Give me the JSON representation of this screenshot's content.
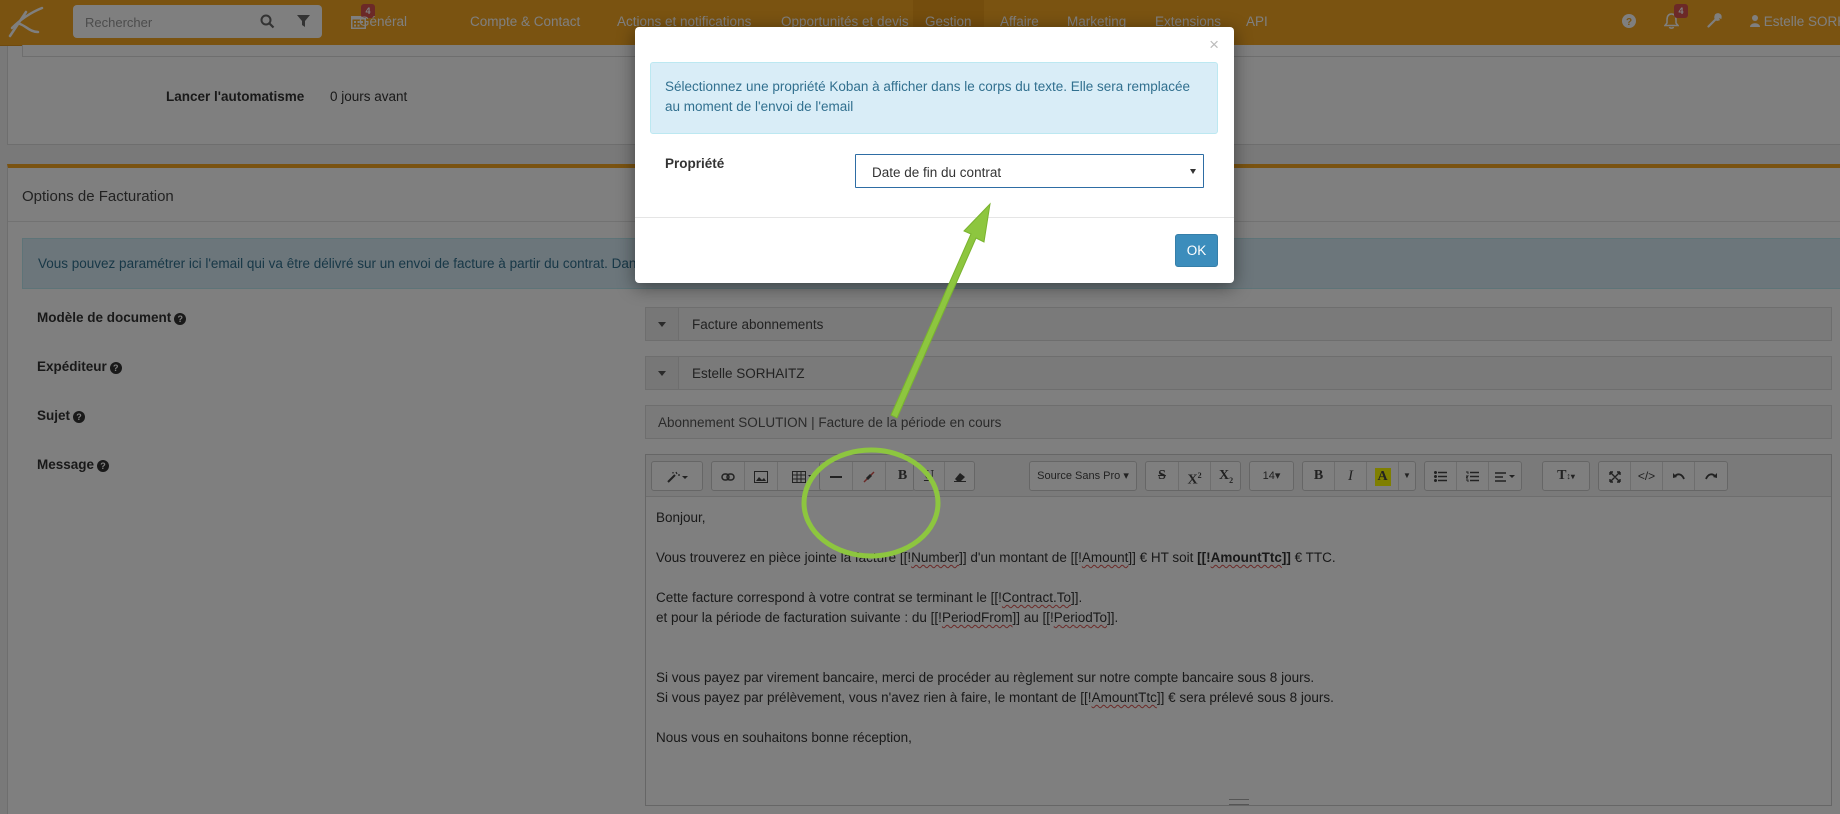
{
  "navbar": {
    "search_placeholder": "Rechercher",
    "calendar_badge": "4",
    "menu": [
      "Général",
      "Compte & Contact",
      "Actions et notifications",
      "Opportunités et devis",
      "Gestion",
      "Affaire",
      "Marketing",
      "Extensions",
      "API"
    ],
    "active_item": "Gestion",
    "notifications_badge": "4",
    "user_name": "Estelle SORH"
  },
  "automation": {
    "label": "Lancer l'automatisme",
    "value": "0 jours avant"
  },
  "billing": {
    "title": "Options de Facturation",
    "info": "Vous pouvez paramétrer ici l'email qui va être délivré sur un envoi de facture à partir du contrat. Dans le",
    "doc_model_label": "Modèle de document",
    "doc_model_value": "Facture abonnements",
    "sender_label": "Expéditeur",
    "sender_value": "Estelle SORHAITZ",
    "subject_label": "Sujet",
    "subject_value": "Abonnement SOLUTION | Facture de la période en cours",
    "message_label": "Message"
  },
  "editor": {
    "font_name": "Source Sans Pro",
    "font_size": "14",
    "lines": {
      "l1": "Bonjour,",
      "l2a": "Vous trouverez en pièce jointe la facture [[!",
      "l2b": "Number",
      "l2c": "]] d'un montant de  [[!",
      "l2d": "Amount",
      "l2e": "]] € HT soit ",
      "l2f": "[[!",
      "l2g": "AmountTtc",
      "l2h": "]]",
      "l2i": " € TTC.",
      "l3a": "Cette facture correspond à votre contrat se terminant le [[!",
      "l3b": "Contract.To",
      "l3c": "]].",
      "l4a": "et pour la période de facturation suivante : du [[!",
      "l4b": "PeriodFrom",
      "l4c": "]] au [[!",
      "l4d": "PeriodTo",
      "l4e": "]].",
      "l5": "Si vous payez par virement bancaire, merci de procéder au règlement sur notre compte bancaire sous 8 jours.",
      "l6a": "Si vous payez par prélèvement, vous n'avez rien à faire, le montant de [[!",
      "l6b": "AmountTtc",
      "l6c": "]] € sera prélevé sous 8 jours.",
      "l7": "Nous vous en souhaitons bonne réception,"
    }
  },
  "modal": {
    "close": "×",
    "info": "Sélectionnez une propriété Koban à afficher dans le corps du texte. Elle sera remplacée au moment de l'envoi de l'email",
    "property_label": "Propriété",
    "property_value": "Date de fin du contrat",
    "ok_label": "OK"
  },
  "colors": {
    "brand": "#f5a623",
    "primary_button": "#3c8dbc",
    "annotation": "#8dc63f",
    "info_bg": "#d9edf7"
  }
}
